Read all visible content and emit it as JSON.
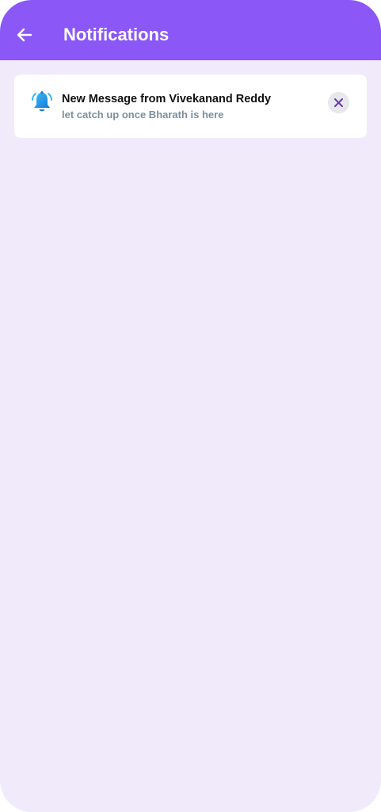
{
  "header": {
    "title": "Notifications",
    "back_icon": "arrow-left-icon",
    "background_color": "#8b57f6"
  },
  "notifications": [
    {
      "icon": "bell-icon",
      "title": "New Message from Vivekanand Reddy",
      "message": "let catch up once Bharath is here",
      "dismiss_icon": "close-icon"
    }
  ],
  "colors": {
    "page_background": "#f1eafa",
    "card_background": "#ffffff",
    "accent": "#8b57f6",
    "subtitle": "#7b8f9e",
    "close_button": "#e7e8ec"
  }
}
